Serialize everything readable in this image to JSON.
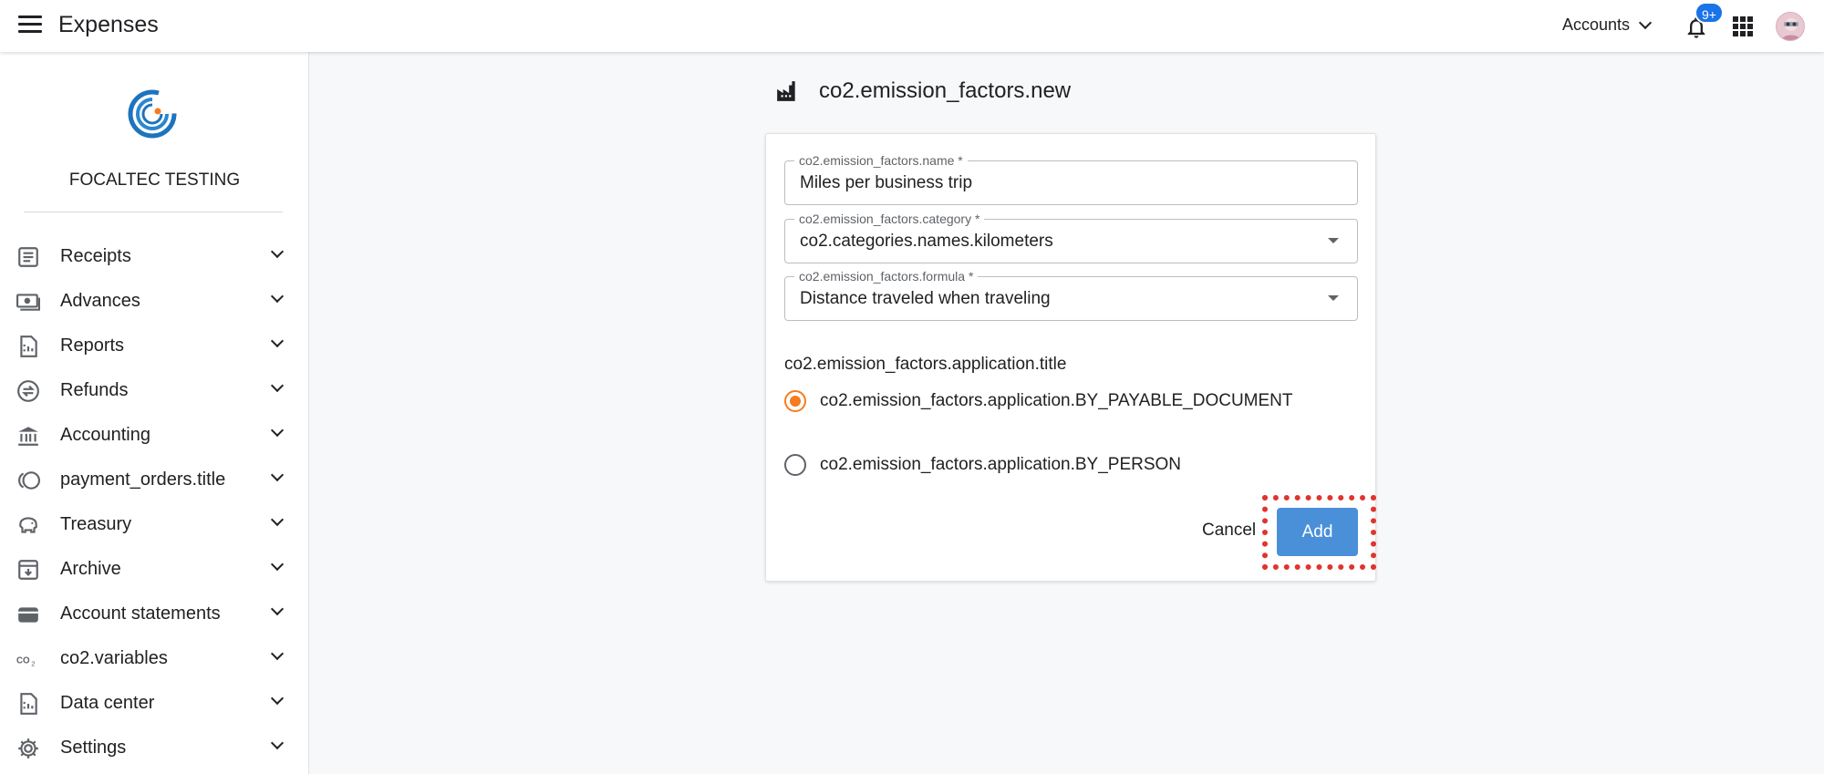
{
  "header": {
    "app_title": "Expenses",
    "accounts_label": "Accounts",
    "notifications_badge": "9+"
  },
  "sidebar": {
    "org_name": "FOCALTEC TESTING",
    "items": [
      {
        "label": "Receipts",
        "icon": "receipt-icon"
      },
      {
        "label": "Advances",
        "icon": "cash-icon"
      },
      {
        "label": "Reports",
        "icon": "report-icon"
      },
      {
        "label": "Refunds",
        "icon": "refund-icon"
      },
      {
        "label": "Accounting",
        "icon": "bank-icon"
      },
      {
        "label": "payment_orders.title",
        "icon": "coins-icon"
      },
      {
        "label": "Treasury",
        "icon": "piggy-bank-icon"
      },
      {
        "label": "Archive",
        "icon": "archive-icon"
      },
      {
        "label": "Account statements",
        "icon": "wallet-icon"
      },
      {
        "label": "co2.variables",
        "icon": "co2-icon"
      },
      {
        "label": "Data center",
        "icon": "data-center-icon"
      },
      {
        "label": "Settings",
        "icon": "gear-icon"
      }
    ]
  },
  "main": {
    "page_title": "co2.emission_factors.new",
    "form": {
      "name_label": "co2.emission_factors.name *",
      "name_value": "Miles per business trip",
      "category_label": "co2.emission_factors.category *",
      "category_value": "co2.categories.names.kilometers",
      "formula_label": "co2.emission_factors.formula *",
      "formula_value": "Distance traveled when traveling",
      "application_title": "co2.emission_factors.application.title",
      "options": [
        {
          "label": "co2.emission_factors.application.BY_PAYABLE_DOCUMENT",
          "selected": true
        },
        {
          "label": "co2.emission_factors.application.BY_PERSON",
          "selected": false
        }
      ],
      "cancel_label": "Cancel",
      "add_label": "Add"
    }
  },
  "colors": {
    "primary_button": "#4a90d9",
    "radio_accent": "#f57c1f",
    "badge": "#1a73e8",
    "highlight": "#e0342c"
  }
}
